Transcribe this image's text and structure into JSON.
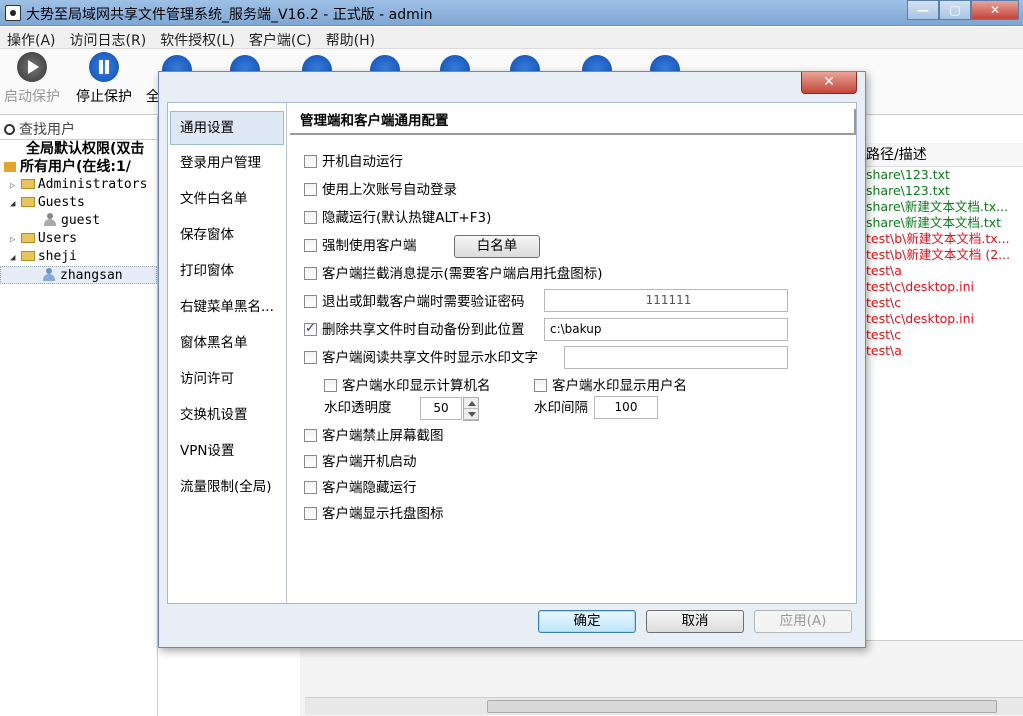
{
  "window": {
    "title": "大势至局域网共享文件管理系统_服务端_V16.2 - 正式版 - admin"
  },
  "menu": [
    "操作(A)",
    "访问日志(R)",
    "软件授权(L)",
    "客户端(C)",
    "帮助(H)"
  ],
  "toolbar": {
    "start_label": "启动保护",
    "stop_label": "停止保护",
    "third_label": "全"
  },
  "left": {
    "search_placeholder": "查找用户",
    "global_perm": "全局默认权限(双击",
    "all_users": "所有用户(在线:1/",
    "groups": [
      {
        "name": "Administrators"
      },
      {
        "name": "Guests",
        "users": [
          "guest"
        ]
      },
      {
        "name": "Users"
      },
      {
        "name": "sheji",
        "users": [
          "zhangsan"
        ]
      }
    ]
  },
  "right": {
    "header": "路径/描述",
    "rows": [
      {
        "text": "share\\123.txt",
        "color": "green"
      },
      {
        "text": "share\\123.txt",
        "color": "green"
      },
      {
        "text": "share\\新建文本文档.tx...",
        "color": "green"
      },
      {
        "text": "share\\新建文本文档.txt",
        "color": "green"
      },
      {
        "text": "test\\b\\新建文本文档.tx...",
        "color": "red"
      },
      {
        "text": "test\\b\\新建文本文档 (2...",
        "color": "red"
      },
      {
        "text": "test\\a",
        "color": "red"
      },
      {
        "text": "test\\c\\desktop.ini",
        "color": "red"
      },
      {
        "text": "test\\c",
        "color": "red"
      },
      {
        "text": "test\\c\\desktop.ini",
        "color": "red"
      },
      {
        "text": "test\\c",
        "color": "red"
      },
      {
        "text": "test\\a",
        "color": "red"
      }
    ]
  },
  "dialog": {
    "close_glyph": "✕",
    "nav": [
      "通用设置",
      "登录用户管理",
      "文件白名单",
      "保存窗体",
      "打印窗体",
      "右键菜单黑名...",
      "窗体黑名单",
      "访问许可",
      "交换机设置",
      "VPN设置",
      "流量限制(全局)"
    ],
    "section_title": "管理端和客户端通用配置",
    "opt_autorun": "开机自动运行",
    "opt_autologin": "使用上次账号自动登录",
    "opt_hidden": "隐藏运行(默认热键ALT+F3)",
    "opt_force_client": "强制使用客户端",
    "whitelist_button": "白名单",
    "opt_intercept_msg": "客户端拦截消息提示(需要客户端启用托盘图标)",
    "opt_exit_password": "退出或卸载客户端时需要验证密码",
    "exit_password_value": "111111",
    "opt_backup": "删除共享文件时自动备份到此位置",
    "backup_path": "c:\\bakup",
    "opt_watermark_text": "客户端阅读共享文件时显示水印文字",
    "watermark_text_value": "",
    "opt_wm_computer": "客户端水印显示计算机名",
    "opt_wm_user": "客户端水印显示用户名",
    "wm_opacity_label": "水印透明度",
    "wm_opacity_value": "50",
    "wm_interval_label": "水印间隔",
    "wm_interval_value": "100",
    "opt_no_screenshot": "客户端禁止屏幕截图",
    "opt_client_autostart": "客户端开机启动",
    "opt_client_hidden": "客户端隐藏运行",
    "opt_client_tray": "客户端显示托盘图标",
    "ok_label": "确定",
    "cancel_label": "取消",
    "apply_label": "应用(A)"
  }
}
